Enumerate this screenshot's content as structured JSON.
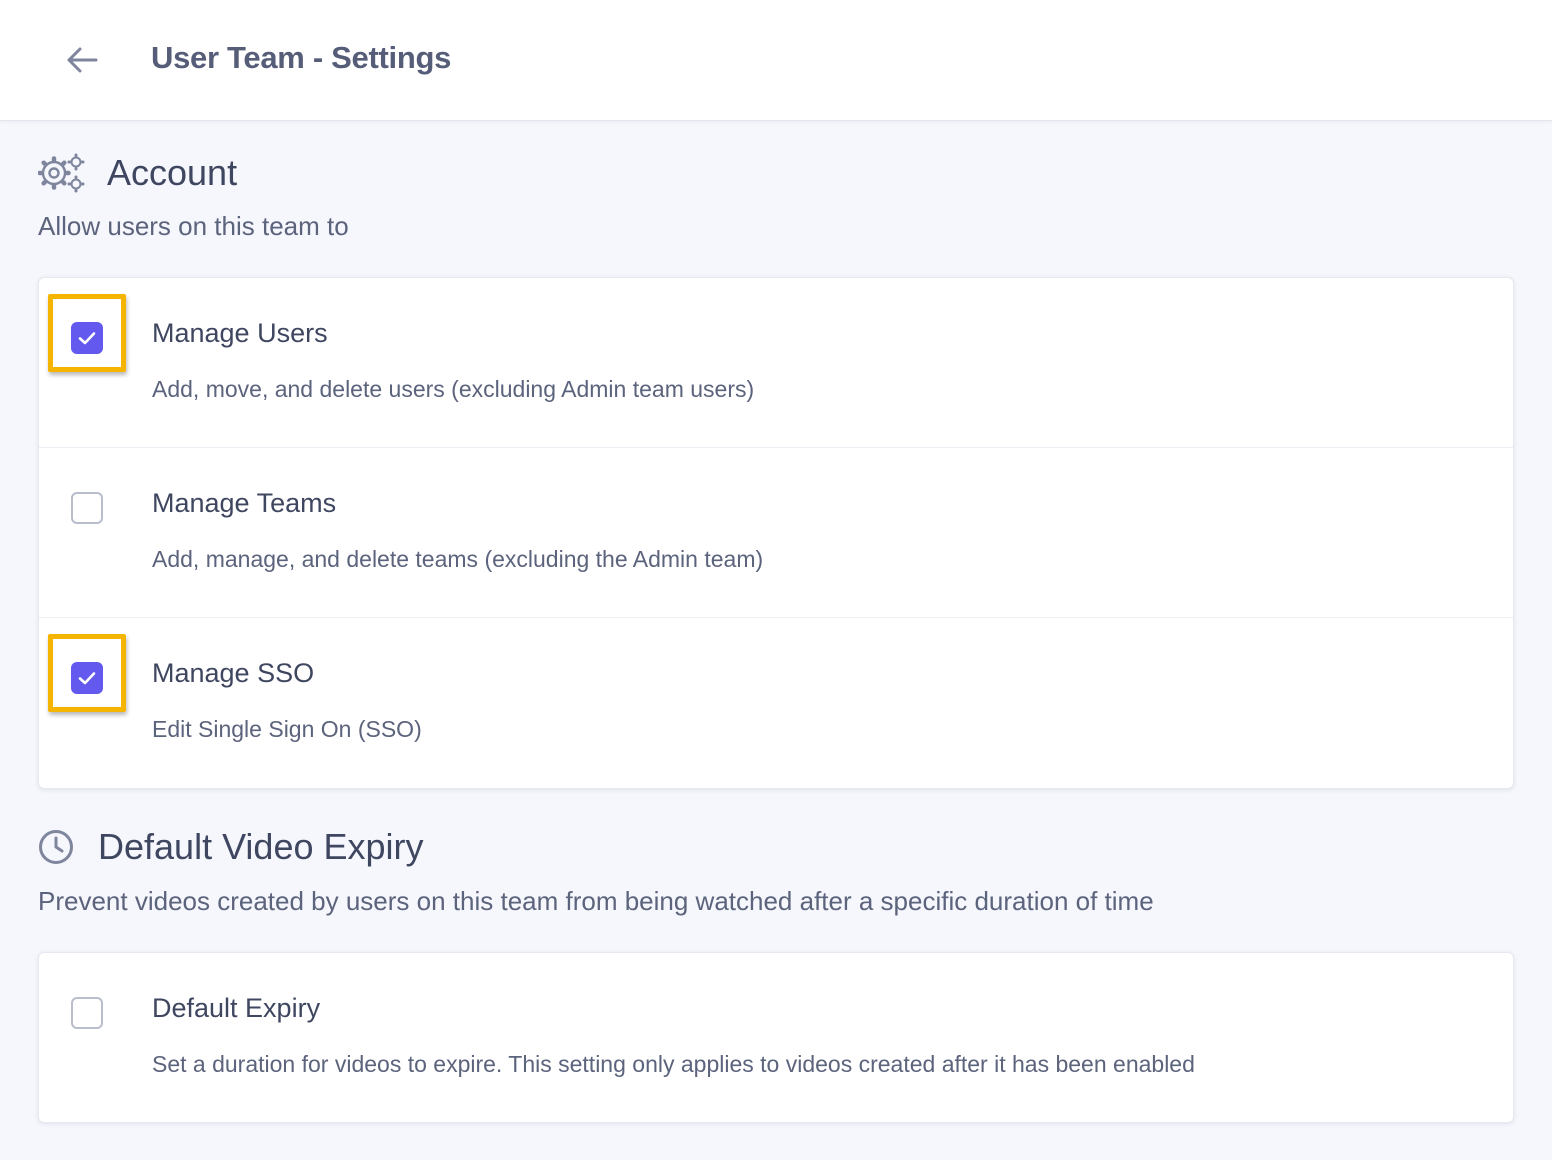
{
  "header": {
    "title": "User Team - Settings"
  },
  "account": {
    "title": "Account",
    "subtitle": "Allow users on this team to",
    "items": [
      {
        "title": "Manage Users",
        "description": "Add, move, and delete users (excluding Admin team users)",
        "checked": true,
        "highlighted": true
      },
      {
        "title": "Manage Teams",
        "description": "Add, manage, and delete teams (excluding the Admin team)",
        "checked": false,
        "highlighted": false
      },
      {
        "title": "Manage SSO",
        "description": "Edit Single Sign On (SSO)",
        "checked": true,
        "highlighted": true
      }
    ]
  },
  "expiry": {
    "title": "Default Video Expiry",
    "subtitle": "Prevent videos created by users on this team from being watched after a specific duration of time",
    "items": [
      {
        "title": "Default Expiry",
        "description": "Set a duration for videos to expire. This setting only applies to videos created after it has been enabled",
        "checked": false,
        "highlighted": false
      }
    ]
  },
  "icons": {
    "back": "arrow-left-icon",
    "account": "gears-icon",
    "expiry": "clock-icon"
  },
  "colors": {
    "accent": "#6359ee",
    "highlight": "#f5b400",
    "background": "#f5f7fc",
    "text": "#3f4660"
  }
}
